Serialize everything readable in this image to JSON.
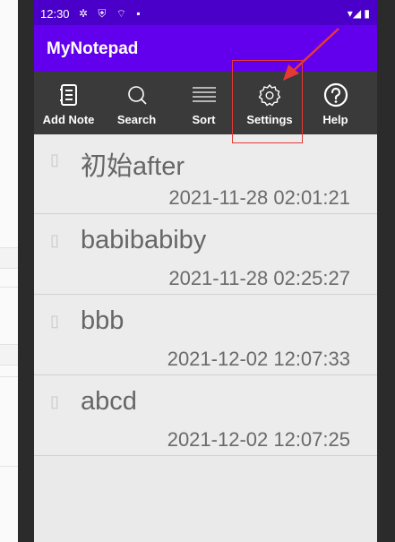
{
  "status": {
    "time": "12:30",
    "left_icons": "✲ ⛨ ⌔ ▪",
    "right_icons": "▾◢ ▮"
  },
  "app": {
    "title": "MyNotepad"
  },
  "toolbar": {
    "add_note": "Add Note",
    "search": "Search",
    "sort": "Sort",
    "settings": "Settings",
    "help": "Help"
  },
  "notes": [
    {
      "title": "初始after",
      "datetime": "2021-11-28 02:01:21",
      "icon": "note-icon"
    },
    {
      "title": "babibabiby",
      "datetime": "2021-11-28 02:25:27",
      "icon": "note-icon"
    },
    {
      "title": "bbb",
      "datetime": "2021-12-02 12:07:33",
      "icon": "note-icon"
    },
    {
      "title": "abcd",
      "datetime": "2021-12-02 12:07:25",
      "icon": "note-icon"
    }
  ],
  "colors": {
    "status_bar": "#4a00c8",
    "app_bar": "#6200ee",
    "toolbar": "#3a3a3a",
    "annotation": "#e53935"
  }
}
